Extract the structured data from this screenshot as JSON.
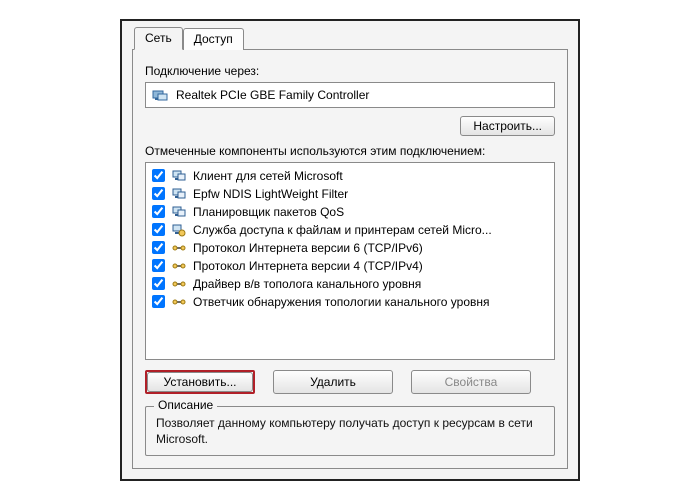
{
  "tabs": {
    "network": "Сеть",
    "access": "Доступ"
  },
  "connect_using_label": "Подключение через:",
  "adapter_name": "Realtek PCIe GBE Family Controller",
  "configure_btn": "Настроить...",
  "components_label": "Отмеченные компоненты используются этим подключением:",
  "items": [
    {
      "label": "Клиент для сетей Microsoft",
      "checked": true,
      "icon": "client"
    },
    {
      "label": "Epfw NDIS LightWeight Filter",
      "checked": true,
      "icon": "client"
    },
    {
      "label": "Планировщик пакетов QoS",
      "checked": true,
      "icon": "client"
    },
    {
      "label": "Служба доступа к файлам и принтерам сетей Micro...",
      "checked": true,
      "icon": "service"
    },
    {
      "label": "Протокол Интернета версии 6 (TCP/IPv6)",
      "checked": true,
      "icon": "protocol"
    },
    {
      "label": "Протокол Интернета версии 4 (TCP/IPv4)",
      "checked": true,
      "icon": "protocol"
    },
    {
      "label": "Драйвер в/в тополога канального уровня",
      "checked": true,
      "icon": "protocol"
    },
    {
      "label": "Ответчик обнаружения топологии канального уровня",
      "checked": true,
      "icon": "protocol"
    }
  ],
  "buttons": {
    "install": "Установить...",
    "uninstall": "Удалить",
    "properties": "Свойства"
  },
  "description": {
    "legend": "Описание",
    "text": "Позволяет данному компьютеру получать доступ к ресурсам в сети Microsoft."
  }
}
